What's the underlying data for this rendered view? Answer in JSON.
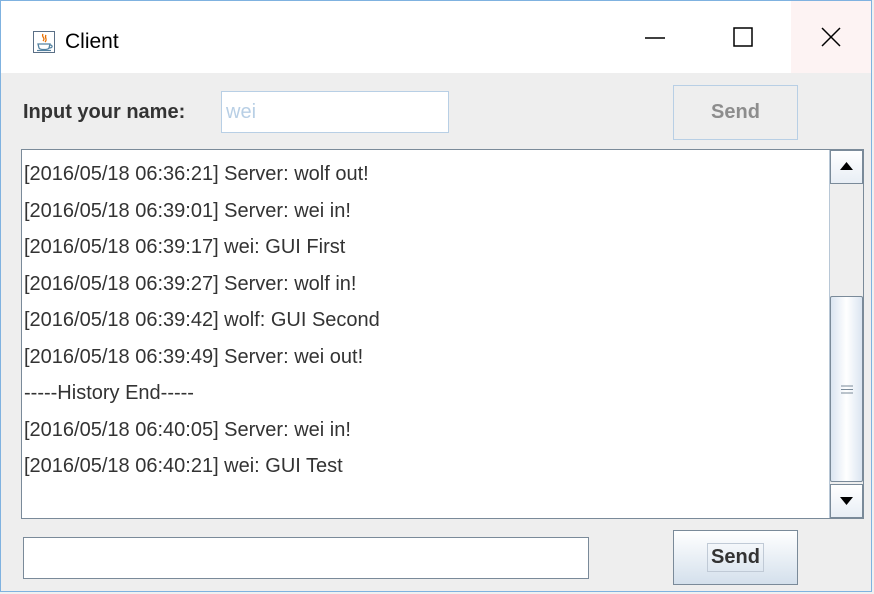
{
  "window": {
    "title": "Client",
    "icon": "java-cup-icon"
  },
  "controls": {
    "minimize": "minimize-icon",
    "maximize": "maximize-icon",
    "close": "close-icon"
  },
  "name_row": {
    "label": "Input your name:",
    "name_value": "wei",
    "send_label": "Send"
  },
  "chat": {
    "lines": [
      "[2016/05/18 06:36:21] Server: wolf out!",
      "[2016/05/18 06:39:01] Server: wei in!",
      "[2016/05/18 06:39:17] wei: GUI First",
      "[2016/05/18 06:39:27] Server: wolf in!",
      "[2016/05/18 06:39:42] wolf: GUI Second",
      "[2016/05/18 06:39:49] Server: wei out!",
      "-----History End-----",
      "[2016/05/18 06:40:05] Server: wei in!",
      "[2016/05/18 06:40:21] wei: GUI Test"
    ]
  },
  "message_row": {
    "message_value": "",
    "send_label": "Send"
  },
  "colors": {
    "window_border": "#7fb2e0",
    "disabled_text": "#b8cfe5",
    "button_gradient_end": "#d4e0ec"
  }
}
